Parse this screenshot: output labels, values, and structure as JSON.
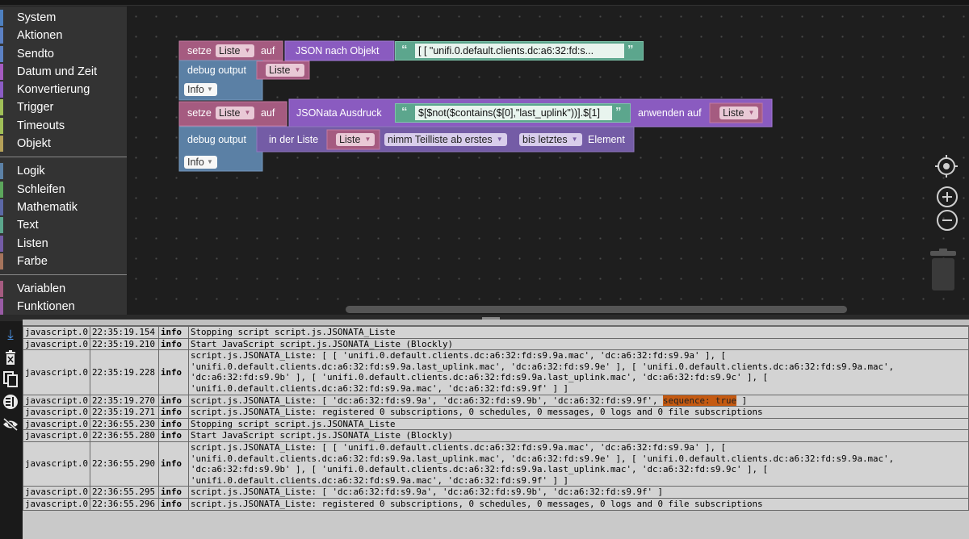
{
  "toolbox": {
    "groups": [
      [
        {
          "label": "System",
          "color": "#4e80c0"
        },
        {
          "label": "Aktionen",
          "color": "#5c81c4"
        },
        {
          "label": "Sendto",
          "color": "#5c81c4"
        },
        {
          "label": "Datum und Zeit",
          "color": "#a55bc0"
        },
        {
          "label": "Konvertierung",
          "color": "#8b5cc4"
        },
        {
          "label": "Trigger",
          "color": "#a0bf58"
        },
        {
          "label": "Timeouts",
          "color": "#a0bf58"
        },
        {
          "label": "Objekt",
          "color": "#b5a159"
        }
      ],
      [
        {
          "label": "Logik",
          "color": "#5c81a6"
        },
        {
          "label": "Schleifen",
          "color": "#5ca65c"
        },
        {
          "label": "Mathematik",
          "color": "#5c68a6"
        },
        {
          "label": "Text",
          "color": "#5ca68d"
        },
        {
          "label": "Listen",
          "color": "#745ca6"
        },
        {
          "label": "Farbe",
          "color": "#a6745c"
        }
      ],
      [
        {
          "label": "Variablen",
          "color": "#a55b80"
        },
        {
          "label": "Funktionen",
          "color": "#995ba5"
        }
      ]
    ]
  },
  "blocks": {
    "set1": {
      "setze": "setze",
      "var": "Liste",
      "auf": "auf"
    },
    "json1": {
      "label": "JSON nach Objekt",
      "open_quote": "“",
      "close_quote": "”",
      "text": "[ [      \"unifi.0.default.clients.dc:a6:32:fd:s..."
    },
    "debug1": {
      "label": "debug output",
      "var": "Liste",
      "level": "Info"
    },
    "set2": {
      "setze": "setze",
      "var": "Liste",
      "auf": "auf"
    },
    "jsonata": {
      "label": "JSONata Ausdruck",
      "open_quote": "“",
      "close_quote": "”",
      "text": "$[$not($contains($[0],\"last_uplink\"))].$[1]",
      "apply": "anwenden auf",
      "var": "Liste"
    },
    "debug2": {
      "label": "debug output",
      "list_label": "in der Liste",
      "var": "Liste",
      "mode": "nimm Teilliste ab erstes",
      "to": "bis letztes",
      "element": "Element",
      "level": "Info"
    }
  },
  "log": {
    "rows": [
      {
        "src": "javascript.0",
        "time": "22:35:19.154",
        "sev": "info",
        "msg": "Stopping script script.js.JSONATA_Liste"
      },
      {
        "src": "javascript.0",
        "time": "22:35:19.210",
        "sev": "info",
        "msg": "Start JavaScript script.js.JSONATA_Liste (Blockly)"
      },
      {
        "src": "javascript.0",
        "time": "22:35:19.228",
        "sev": "info",
        "msg": "script.js.JSONATA_Liste: [ [ 'unifi.0.default.clients.dc:a6:32:fd:s9.9a.mac', 'dc:a6:32:fd:s9.9a' ], [ 'unifi.0.default.clients.dc:a6:32:fd:s9.9a.last_uplink.mac', 'dc:a6:32:fd:s9.9e' ], [ 'unifi.0.default.clients.dc:a6:32:fd:s9.9a.mac', 'dc:a6:32:fd:s9.9b' ], [ 'unifi.0.default.clients.dc:a6:32:fd:s9.9a.last_uplink.mac', 'dc:a6:32:fd:s9.9c' ], [ 'unifi.0.default.clients.dc:a6:32:fd:s9.9a.mac', 'dc:a6:32:fd:s9.9f' ] ]"
      },
      {
        "src": "javascript.0",
        "time": "22:35:19.270",
        "sev": "info",
        "msg": "script.js.JSONATA_Liste: [ 'dc:a6:32:fd:s9.9a', 'dc:a6:32:fd:s9.9b', 'dc:a6:32:fd:s9.9f', ",
        "highlight": "sequence: true",
        "tail": " ]"
      },
      {
        "src": "javascript.0",
        "time": "22:35:19.271",
        "sev": "info",
        "msg": "script.js.JSONATA_Liste: registered 0 subscriptions, 0 schedules, 0 messages, 0 logs and 0 file subscriptions"
      },
      {
        "src": "javascript.0",
        "time": "22:36:55.230",
        "sev": "info",
        "msg": "Stopping script script.js.JSONATA_Liste"
      },
      {
        "src": "javascript.0",
        "time": "22:36:55.280",
        "sev": "info",
        "msg": "Start JavaScript script.js.JSONATA_Liste (Blockly)"
      },
      {
        "src": "javascript.0",
        "time": "22:36:55.290",
        "sev": "info",
        "msg": "script.js.JSONATA_Liste: [ [ 'unifi.0.default.clients.dc:a6:32:fd:s9.9a.mac', 'dc:a6:32:fd:s9.9a' ], [ 'unifi.0.default.clients.dc:a6:32:fd:s9.9a.last_uplink.mac', 'dc:a6:32:fd:s9.9e' ], [ 'unifi.0.default.clients.dc:a6:32:fd:s9.9a.mac', 'dc:a6:32:fd:s9.9b' ], [ 'unifi.0.default.clients.dc:a6:32:fd:s9.9a.last_uplink.mac', 'dc:a6:32:fd:s9.9c' ], [ 'unifi.0.default.clients.dc:a6:32:fd:s9.9a.mac', 'dc:a6:32:fd:s9.9f' ] ]"
      },
      {
        "src": "javascript.0",
        "time": "22:36:55.295",
        "sev": "info",
        "msg": "script.js.JSONATA_Liste: [ 'dc:a6:32:fd:s9.9a', 'dc:a6:32:fd:s9.9b', 'dc:a6:32:fd:s9.9f' ]"
      },
      {
        "src": "javascript.0",
        "time": "22:36:55.296",
        "sev": "info",
        "msg": "script.js.JSONATA_Liste: registered 0 subscriptions, 0 schedules, 0 messages, 0 logs and 0 file subscriptions"
      }
    ]
  },
  "icons": {
    "side": [
      "scroll-down-icon",
      "delete-log-icon",
      "copy-icon",
      "columns-icon",
      "hide-icon"
    ],
    "workspace": [
      "recenter-icon",
      "zoom-in-icon",
      "zoom-out-icon",
      "trash-icon"
    ]
  }
}
